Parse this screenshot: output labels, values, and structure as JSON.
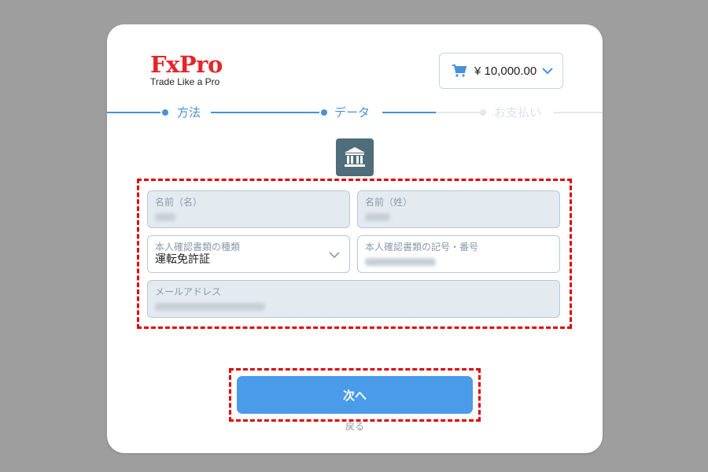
{
  "brand": {
    "logo_text": "FxPro",
    "tagline": "Trade Like a Pro"
  },
  "cart": {
    "icon": "cart-icon",
    "amount": "¥ 10,000.00"
  },
  "steps": [
    {
      "label": "方法",
      "state": "done"
    },
    {
      "label": "データ",
      "state": "active"
    },
    {
      "label": "お支払い",
      "state": "inactive"
    }
  ],
  "form": {
    "section_icon": "bank-icon",
    "first_name": {
      "label": "名前（名）",
      "value": ""
    },
    "last_name": {
      "label": "名前（姓）",
      "value": ""
    },
    "id_type": {
      "label": "本人確認書類の種類",
      "value": "運転免許証"
    },
    "id_number": {
      "label": "本人確認書類の記号・番号",
      "value": ""
    },
    "email": {
      "label": "メールアドレス",
      "value": ""
    }
  },
  "actions": {
    "next_label": "次へ",
    "back_label": "戻る"
  },
  "colors": {
    "brand_red": "#e4262b",
    "accent_blue": "#4a90d9",
    "button_blue": "#4a9be8",
    "highlight_red": "#e00000"
  }
}
